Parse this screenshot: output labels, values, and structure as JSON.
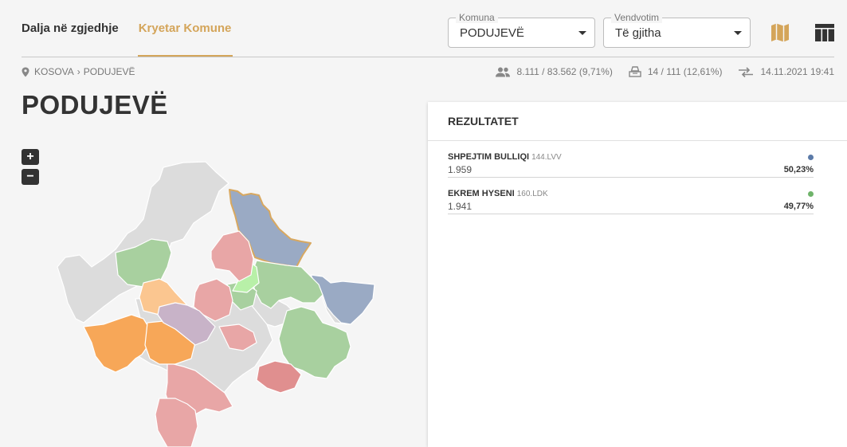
{
  "tabs": [
    {
      "label": "Dalja në zgjedhje",
      "active": false
    },
    {
      "label": "Kryetar Komune",
      "active": true
    }
  ],
  "filters": {
    "komuna": {
      "label": "Komuna",
      "value": "PODUJEVË"
    },
    "vendvotim": {
      "label": "Vendvotim",
      "value": "Të gjitha"
    }
  },
  "breadcrumb": {
    "root": "KOSOVA",
    "current": "PODUJEVË"
  },
  "stats": {
    "turnout": "8.111 / 83.562 (9,71%)",
    "stations": "14 / 111 (12,61%)",
    "updated": "14.11.2021 19:41"
  },
  "title": "PODUJEVË",
  "zoom": {
    "in": "+",
    "out": "−"
  },
  "results": {
    "heading": "REZULTATET",
    "candidates": [
      {
        "name": "SHPEJTIM BULLIQI",
        "party": "144.LVV",
        "votes": "1.959",
        "percent": "50,23%",
        "color": "#5b7aa8"
      },
      {
        "name": "EKREM HYSENI",
        "party": "160.LDK",
        "votes": "1.941",
        "percent": "49,77%",
        "color": "#6fb36a"
      }
    ]
  },
  "colors": {
    "accent": "#d4a55a",
    "lvv": "#8fa3c4",
    "ldk": "#9fcc95",
    "pdk": "#e3a0a0",
    "aak": "#f7a55a",
    "grey": "#dcdcdc"
  }
}
